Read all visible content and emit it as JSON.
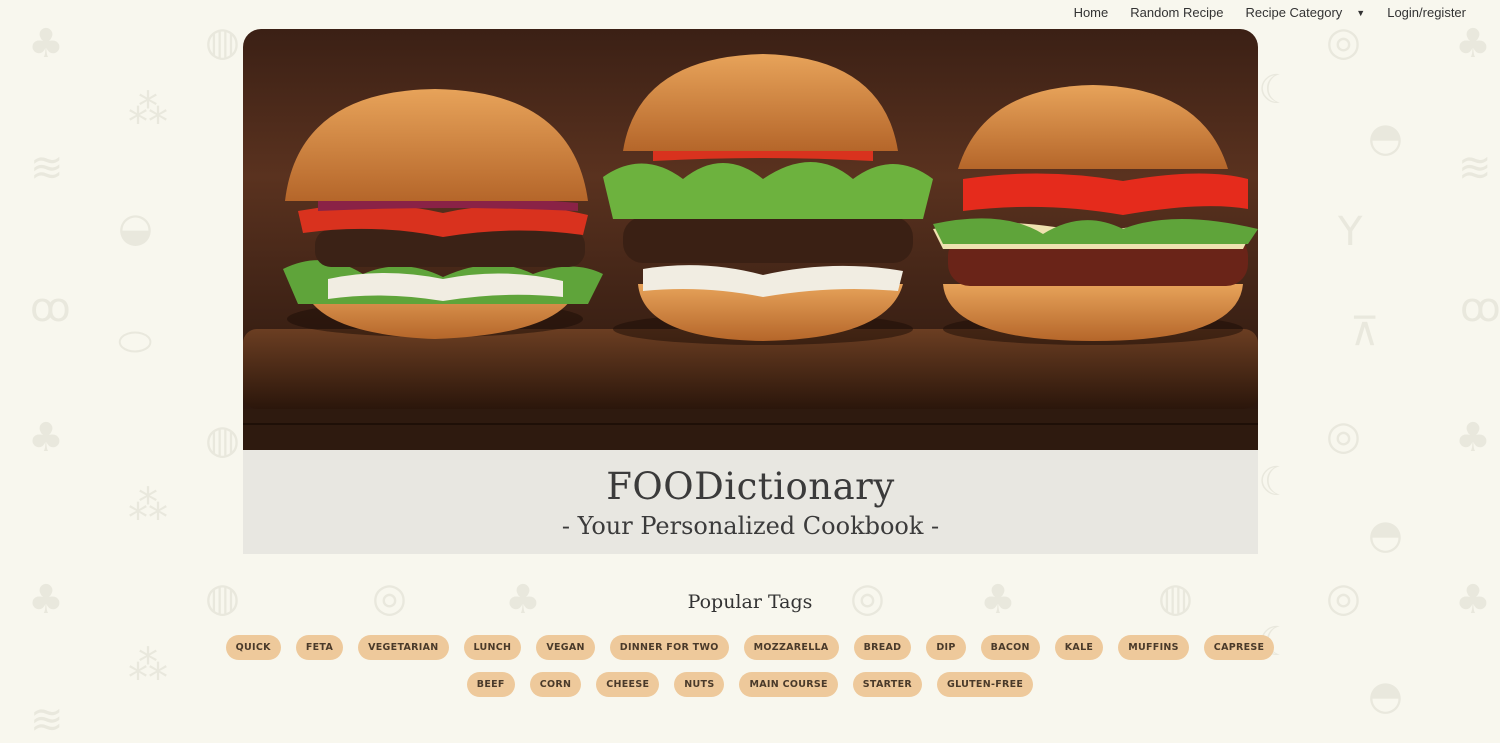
{
  "nav": {
    "home": "Home",
    "random": "Random Recipe",
    "category": "Recipe Category",
    "login": "Login/register"
  },
  "banner": {
    "title": "FOODictionary",
    "subtitle": "- Your Personalized Cookbook -"
  },
  "tags": {
    "heading": "Popular Tags",
    "row1": [
      "QUICK",
      "FETA",
      "VEGETARIAN",
      "LUNCH",
      "VEGAN",
      "DINNER FOR TWO",
      "MOZZARELLA",
      "BREAD",
      "DIP",
      "BACON",
      "KALE",
      "MUFFINS",
      "CAPRESE"
    ],
    "row2": [
      "BEEF",
      "CORN",
      "CHEESE",
      "NUTS",
      "MAIN COURSE",
      "STARTER",
      "GLUTEN-FREE"
    ]
  },
  "colors": {
    "background": "#f8f7ee",
    "tag_bg": "#eec99b",
    "banner_bg": "#e8e7e1"
  },
  "icons": [
    "pineapple-icon",
    "grapes-icon",
    "celery-icon",
    "chicken-icon",
    "cherries-icon",
    "bread-icon",
    "watermelon-icon",
    "donut-icon",
    "banana-icon",
    "steak-icon",
    "cocktail-icon",
    "grill-icon",
    "caret-down-icon"
  ]
}
